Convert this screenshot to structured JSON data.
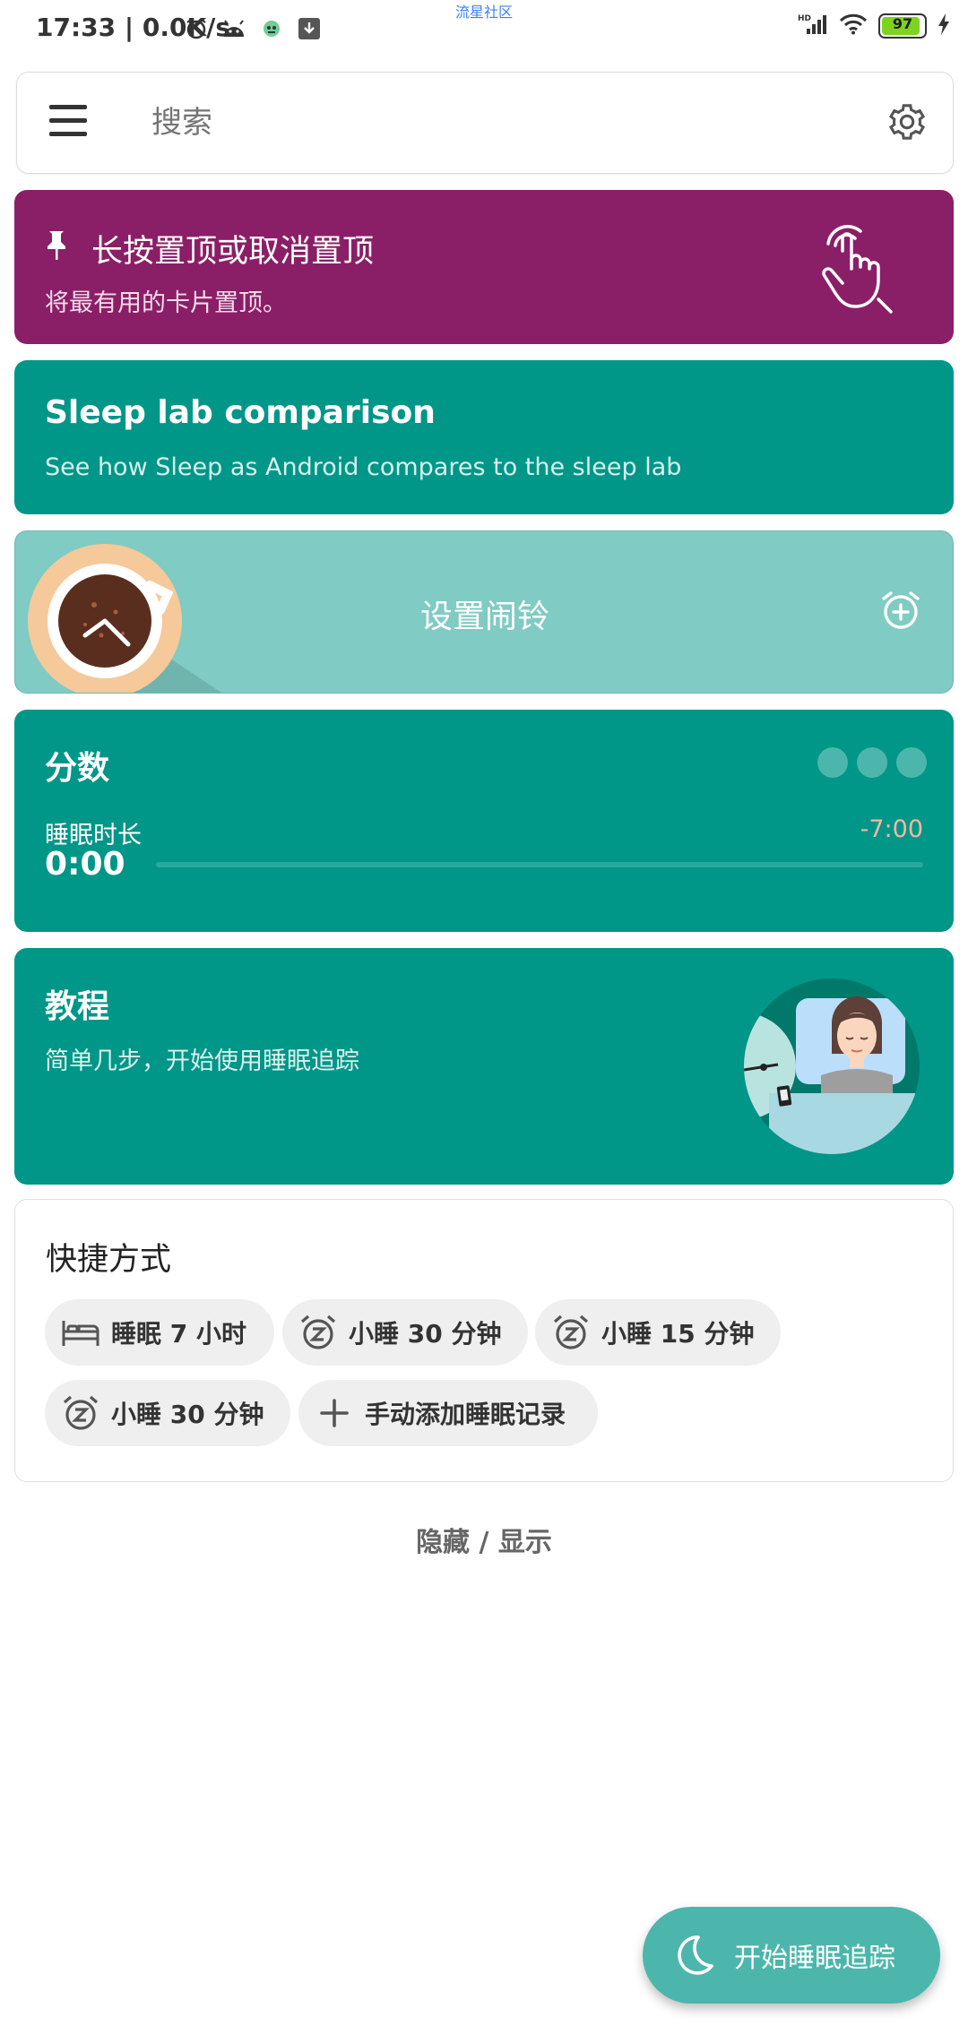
{
  "status_bar": {
    "time": "17:33",
    "speed": "0.0K/s",
    "community": "流星社区",
    "battery": "97",
    "icons": [
      "alarm-icon",
      "android-icon",
      "app-icon",
      "download-icon",
      "signal-hd-icon",
      "wifi-icon",
      "battery-icon",
      "charging-icon"
    ]
  },
  "search": {
    "placeholder": "搜索"
  },
  "pin_card": {
    "title": "长按置顶或取消置顶",
    "subtitle": "将最有用的卡片置顶。",
    "color": "#8a1f67"
  },
  "lab_card": {
    "title": "Sleep lab comparison",
    "subtitle": "See how Sleep as Android compares to the sleep lab",
    "color": "#009688"
  },
  "alarm_card": {
    "label": "设置闹铃",
    "color": "#80cbc4"
  },
  "score_card": {
    "title": "分数",
    "duration_label": "睡眠时长",
    "duration_value": "0:00",
    "target": "-7:00"
  },
  "tutorial_card": {
    "title": "教程",
    "subtitle": "简单几步，开始使用睡眠追踪"
  },
  "shortcuts": {
    "title": "快捷方式",
    "items": [
      {
        "label": "睡眠 7 小时",
        "icon": "bed-icon"
      },
      {
        "label": "小睡 30 分钟",
        "icon": "snooze-alarm-icon"
      },
      {
        "label": "小睡 15 分钟",
        "icon": "snooze-alarm-icon"
      },
      {
        "label": "小睡 30 分钟",
        "icon": "snooze-alarm-icon"
      },
      {
        "label": "手动添加睡眠记录",
        "icon": "plus-icon"
      }
    ]
  },
  "toggle": {
    "label": "隐藏 / 显示"
  },
  "fab": {
    "label": "开始睡眠追踪",
    "color": "#4db6ac"
  }
}
